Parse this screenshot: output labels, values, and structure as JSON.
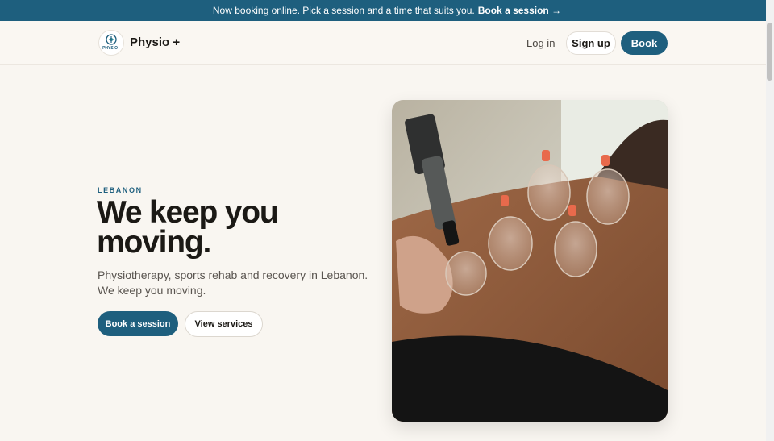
{
  "banner": {
    "text": "Now booking online. Pick a session and a time that suits you.",
    "link": "Book a session →"
  },
  "nav": {
    "logo_text": "PHYSIO+",
    "brand": "Physio +",
    "login": "Log in",
    "signup": "Sign up",
    "book": "Book"
  },
  "hero": {
    "eyebrow": "LEBANON",
    "title": "We keep you moving.",
    "subtitle": "Physiotherapy, sports rehab and recovery in Lebanon. We keep you moving.",
    "primary_cta": "Book a session",
    "secondary_cta": "View services",
    "image_icon": "cupping-therapy-photo"
  },
  "colors": {
    "accent": "#1e5f7e",
    "background": "#f9f6f1",
    "text": "#1b1915"
  }
}
